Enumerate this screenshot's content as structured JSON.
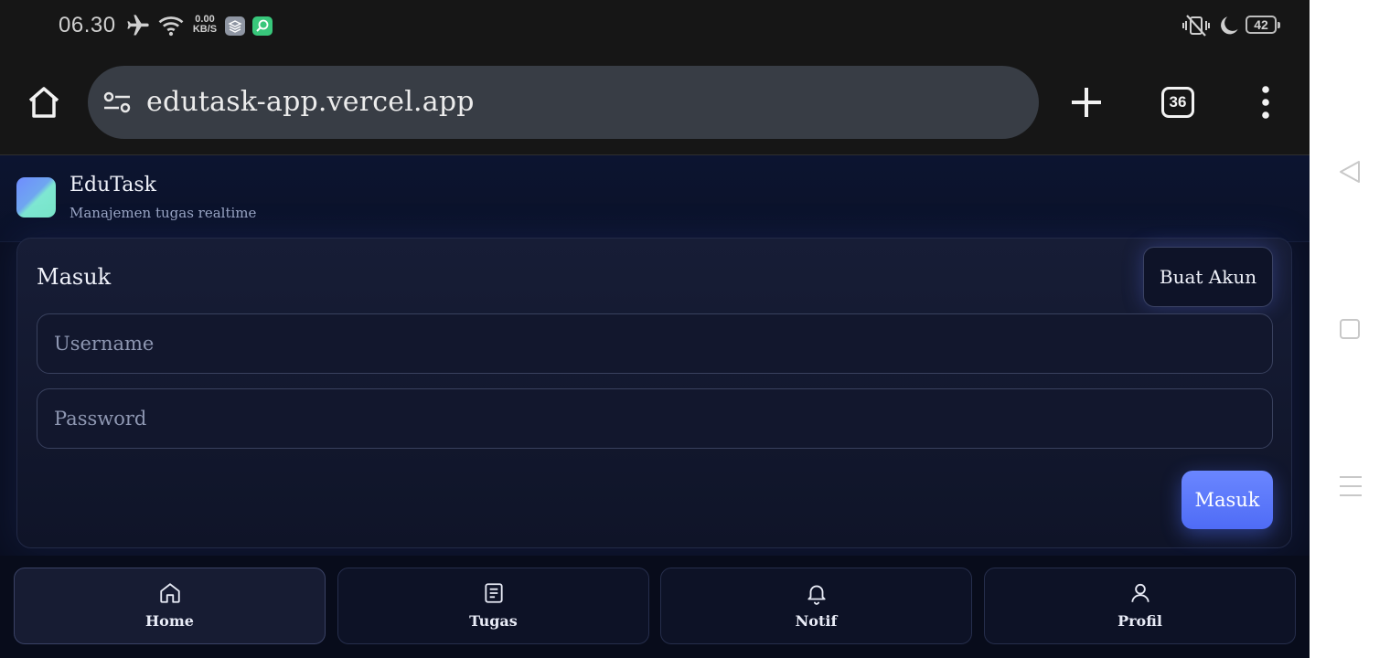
{
  "status_bar": {
    "time": "06.30",
    "speed_value": "0.00",
    "speed_unit": "KB/S",
    "battery": "42",
    "icons": [
      "airplane-icon",
      "wifi-icon",
      "app-badge-icon",
      "app-badge-green-icon",
      "vibrate-off-icon",
      "moon-icon",
      "battery-icon"
    ]
  },
  "browser": {
    "url": "edutask-app.vercel.app",
    "tab_count": "36"
  },
  "app": {
    "name": "EduTask",
    "tagline": "Manajemen tugas realtime"
  },
  "login_card": {
    "title": "Masuk",
    "register_label": "Buat Akun",
    "username_placeholder": "Username",
    "username_value": "",
    "password_placeholder": "Password",
    "password_value": "",
    "submit_label": "Masuk"
  },
  "bottom_nav": {
    "items": [
      {
        "label": "Home",
        "icon": "home-icon",
        "active": true
      },
      {
        "label": "Tugas",
        "icon": "document-icon",
        "active": false
      },
      {
        "label": "Notif",
        "icon": "bell-icon",
        "active": false
      },
      {
        "label": "Profil",
        "icon": "user-icon",
        "active": false
      }
    ]
  },
  "colors": {
    "page_bg": "#0a0f21",
    "accent": "#5b78fb",
    "browser_chrome": "#161616"
  }
}
